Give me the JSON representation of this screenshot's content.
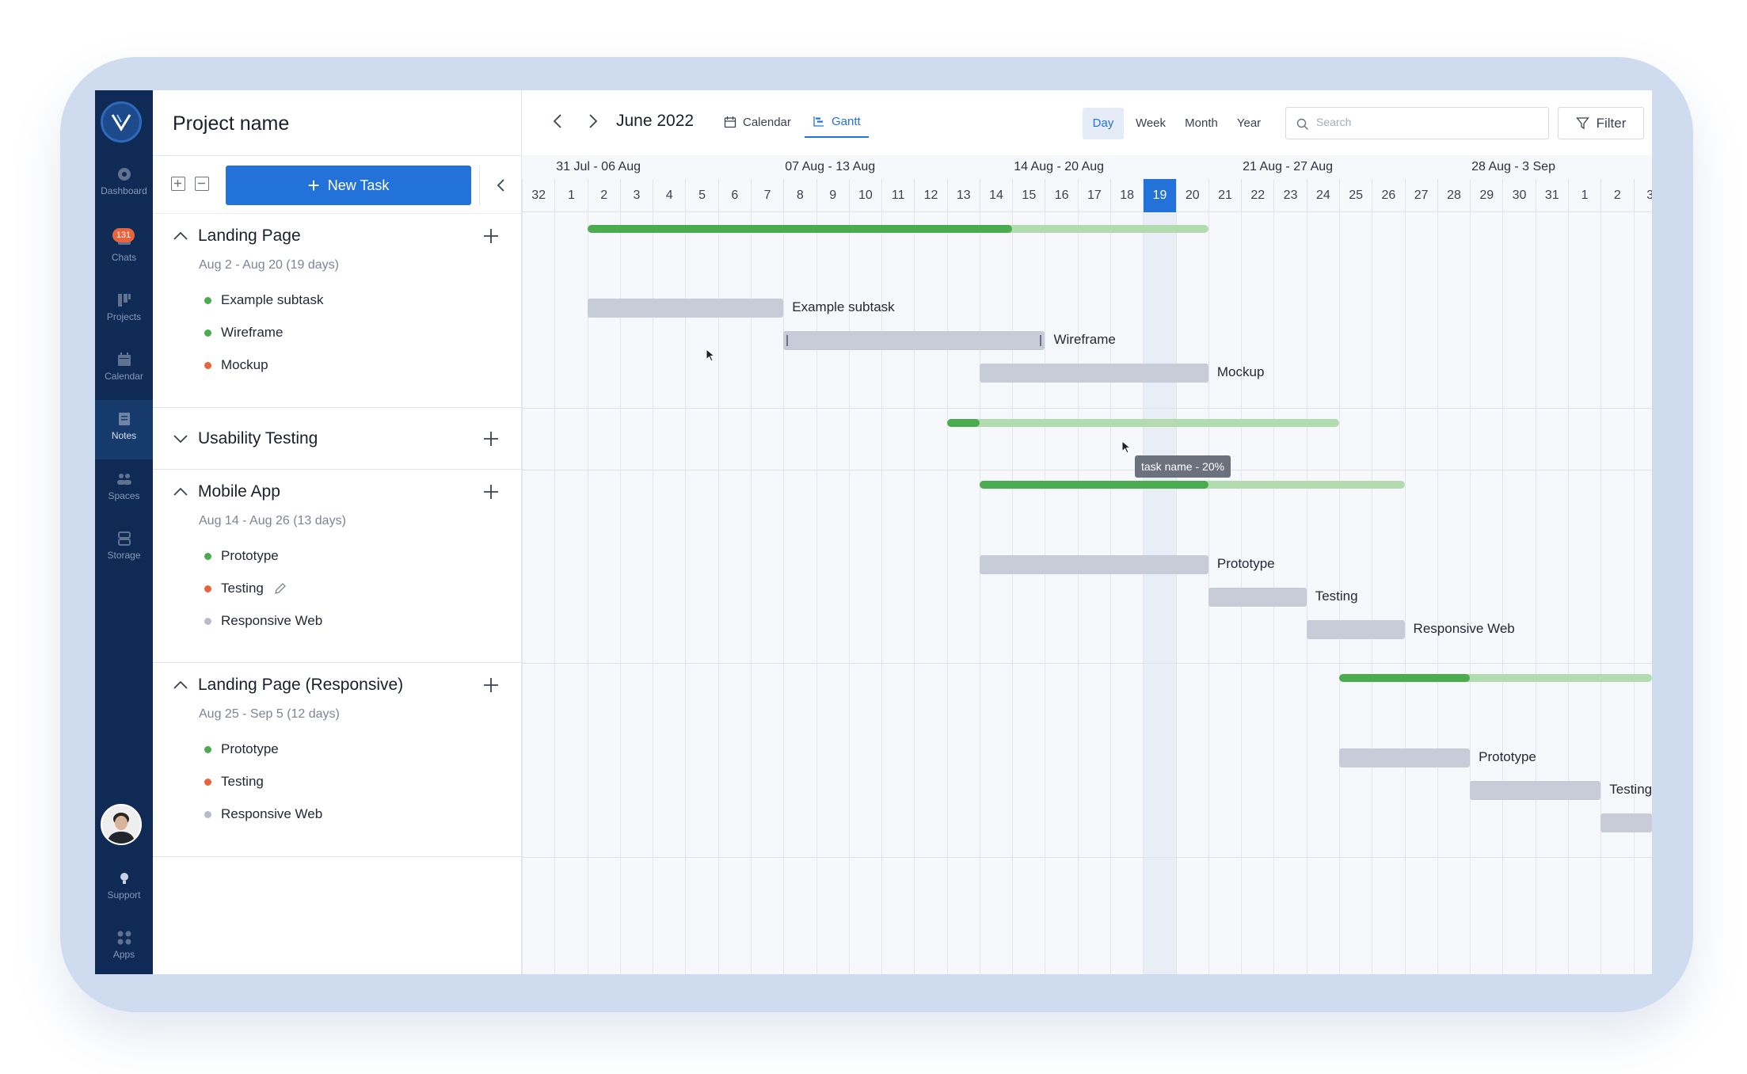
{
  "nav": {
    "items": [
      {
        "label": "Dashboard",
        "icon": "dashboard-icon"
      },
      {
        "label": "Chats",
        "icon": "chat-icon",
        "badge": "131"
      },
      {
        "label": "Projects",
        "icon": "projects-icon"
      },
      {
        "label": "Calendar",
        "icon": "calendar-icon"
      },
      {
        "label": "Notes",
        "icon": "notes-icon",
        "active": true
      },
      {
        "label": "Spaces",
        "icon": "spaces-icon"
      },
      {
        "label": "Storage",
        "icon": "storage-icon"
      }
    ],
    "support_label": "Support",
    "apps_label": "Apps"
  },
  "panel": {
    "project_name": "Project name",
    "new_task_label": "New Task",
    "groups": [
      {
        "title": "Landing Page",
        "dates": "Aug 2 - Aug 20 (19 days)",
        "expanded": true,
        "subtasks": [
          {
            "label": "Example subtask",
            "status_color": "#4bab4f"
          },
          {
            "label": "Wireframe",
            "status_color": "#4bab4f"
          },
          {
            "label": "Mockup",
            "status_color": "#e8643c"
          }
        ]
      },
      {
        "title": "Usability Testing",
        "expanded": false,
        "subtasks": []
      },
      {
        "title": "Mobile App",
        "dates": "Aug 14 - Aug 26 (13 days)",
        "expanded": true,
        "subtasks": [
          {
            "label": "Prototype",
            "status_color": "#4bab4f"
          },
          {
            "label": "Testing",
            "status_color": "#e8643c",
            "editing": true
          },
          {
            "label": "Responsive Web",
            "status_color": "#b7bcc8"
          }
        ]
      },
      {
        "title": "Landing Page (Responsive)",
        "dates": "Aug 25 - Sep 5 (12 days)",
        "expanded": true,
        "subtasks": [
          {
            "label": "Prototype",
            "status_color": "#4bab4f"
          },
          {
            "label": "Testing",
            "status_color": "#e8643c"
          },
          {
            "label": "Responsive Web",
            "status_color": "#b7bcc8"
          }
        ]
      }
    ]
  },
  "toolbar": {
    "month": "June 2022",
    "tabs": [
      {
        "label": "Calendar",
        "icon": "calendar-icon",
        "active": false
      },
      {
        "label": "Gantt",
        "icon": "gantt-icon",
        "active": true
      }
    ],
    "scales": [
      {
        "label": "Day",
        "active": true
      },
      {
        "label": "Week",
        "active": false
      },
      {
        "label": "Month",
        "active": false
      },
      {
        "label": "Year",
        "active": false
      }
    ],
    "search_placeholder": "Search",
    "filter_label": "Filter"
  },
  "timeline": {
    "weeks": [
      "31 Jul - 06 Aug",
      "07 Aug - 13 Aug",
      "14 Aug - 20 Aug",
      "21 Aug - 27 Aug",
      "28 Aug - 3 Sep"
    ],
    "days": [
      "32",
      "1",
      "2",
      "3",
      "4",
      "5",
      "6",
      "7",
      "8",
      "9",
      "10",
      "11",
      "12",
      "13",
      "14",
      "15",
      "16",
      "17",
      "18",
      "19",
      "20",
      "21",
      "22",
      "23",
      "24",
      "25",
      "26",
      "27",
      "28",
      "29",
      "30",
      "31",
      "1",
      "2",
      "3"
    ],
    "today": "19",
    "colors": {
      "progress": "#4bab4f",
      "progress_track": "#b2dcb0",
      "task_bar": "#c8ccd8",
      "today": "#2372d9"
    },
    "summaries": [
      {
        "group": "Landing Page",
        "start_day": "2",
        "end_day": "20",
        "progress_end_day": "15"
      },
      {
        "group": "Usability Testing",
        "start_day": "13",
        "end_day": "24",
        "progress_end_day": "14"
      },
      {
        "group": "Mobile App",
        "start_day": "14",
        "end_day": "26",
        "progress_end_day": "21"
      },
      {
        "group": "Landing Page (Responsive)",
        "start_day": "25",
        "end_day": "3",
        "progress_end_day": "29"
      }
    ],
    "tasks": [
      {
        "label": "Example subtask",
        "start_day": "2",
        "end_day": "7"
      },
      {
        "label": "Wireframe",
        "start_day": "8",
        "end_day": "15"
      },
      {
        "label": "Mockup",
        "start_day": "14",
        "end_day": "20"
      },
      {
        "label": "Prototype",
        "start_day": "14",
        "end_day": "20"
      },
      {
        "label": "Testing",
        "start_day": "21",
        "end_day": "23"
      },
      {
        "label": "Responsive Web",
        "start_day": "24",
        "end_day": "26"
      },
      {
        "label": "Prototype",
        "start_day": "25",
        "end_day": "28"
      },
      {
        "label": "Testing",
        "start_day": "29",
        "end_day": "1"
      },
      {
        "label": "",
        "start_day": "2",
        "end_day": "3"
      }
    ],
    "tooltip": "task name - 20%"
  }
}
